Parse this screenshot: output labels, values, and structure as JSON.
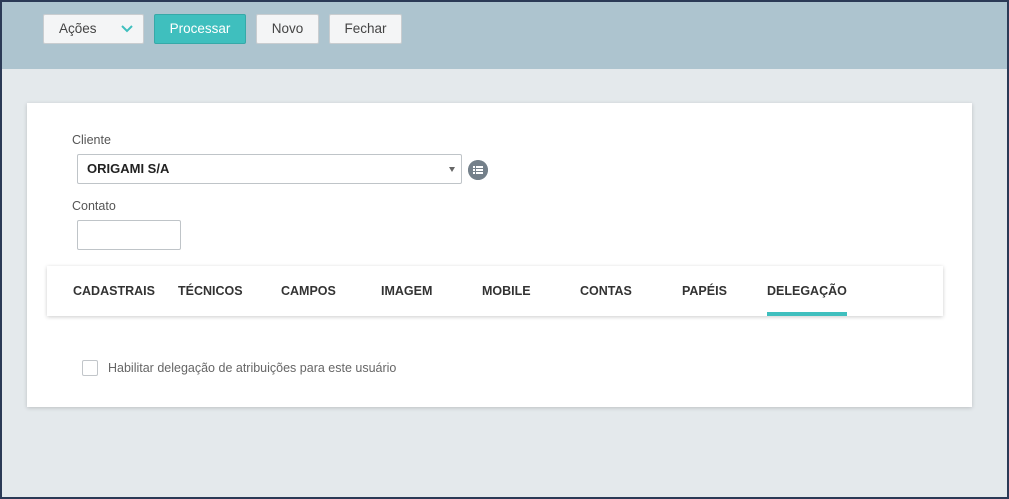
{
  "toolbar": {
    "acoes_label": "Ações",
    "processar_label": "Processar",
    "novo_label": "Novo",
    "fechar_label": "Fechar"
  },
  "form": {
    "cliente_label": "Cliente",
    "cliente_value": "ORIGAMI S/A",
    "contato_label": "Contato",
    "contato_value": ""
  },
  "tabs": [
    {
      "label": "CADASTRAIS"
    },
    {
      "label": "TÉCNICOS"
    },
    {
      "label": "CAMPOS"
    },
    {
      "label": "IMAGEM"
    },
    {
      "label": "MOBILE"
    },
    {
      "label": "CONTAS"
    },
    {
      "label": "PAPÉIS"
    },
    {
      "label": "DELEGAÇÃO",
      "active": true
    }
  ],
  "delegacao": {
    "checkbox_label": "Habilitar delegação de atribuições para este usuário",
    "checked": false
  },
  "colors": {
    "accent": "#3fbfbe",
    "topbar": "#adc4cf",
    "background": "#e4e9ec"
  },
  "icons": {
    "acoes_dropdown": "chevron-down-icon",
    "cliente_select_caret": "caret-down-icon",
    "cliente_list": "list-icon"
  }
}
